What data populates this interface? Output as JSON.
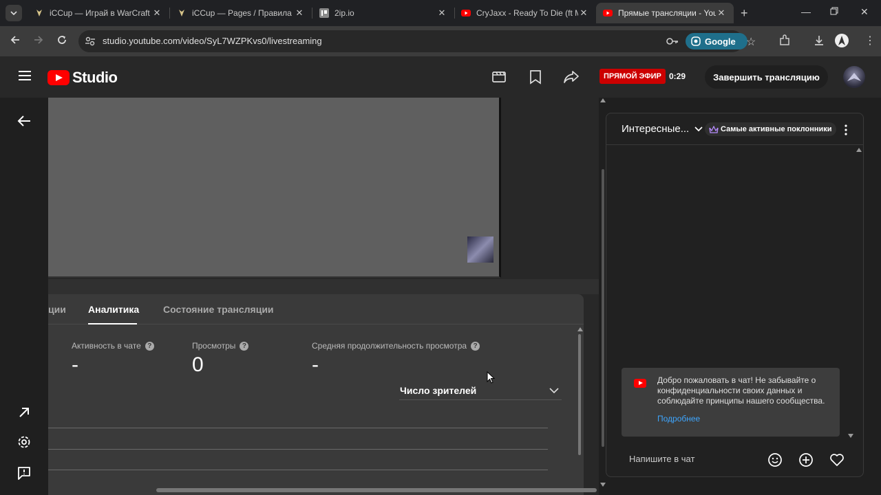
{
  "browser": {
    "tabs": [
      {
        "title": "iCCup — Играй в WarCraft III",
        "active": false
      },
      {
        "title": "iCCup — Pages / Правила лиги",
        "active": false
      },
      {
        "title": "2ip.io",
        "active": false
      },
      {
        "title": "CryJaxx - Ready To Die (ft M",
        "active": false
      },
      {
        "title": "Прямые трансляции - YouTube",
        "active": true
      }
    ],
    "url": "studio.youtube.com/video/SyL7WZPKvs0/livestreaming",
    "search_engine": "Google"
  },
  "studio": {
    "logo_text": "Studio",
    "live_badge": "ПРЯМОЙ ЭФИР",
    "live_time": "0:29",
    "end_button": "Завершить трансляцию"
  },
  "panel": {
    "tabs": [
      "ции",
      "Аналитика",
      "Состояние трансляции"
    ],
    "metrics": [
      {
        "label": "Активность в чате",
        "value": "-"
      },
      {
        "label": "Просмотры",
        "value": "0"
      },
      {
        "label": "Средняя продолжительность просмотра",
        "value": "-"
      }
    ],
    "dropdown": "Число зрителей"
  },
  "chat": {
    "mode": "Интересные...",
    "fans_badge": "Самые активные поклонники",
    "welcome": "Добро пожаловать в чат! Не забывайте о конфиденциальности своих данных и соблюдайте принципы нашего сообщества.",
    "welcome_link": "Подробнее",
    "input_placeholder": "Напишите в чат"
  },
  "colors": {
    "accent_red": "#ff0000",
    "link_blue": "#3ea6ff",
    "live_red": "#cc0000"
  }
}
